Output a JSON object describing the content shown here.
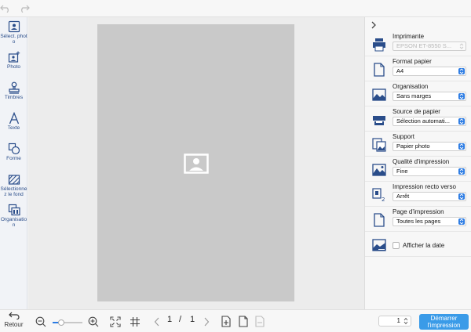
{
  "toolbar_left": {
    "items": [
      {
        "label": "Sélect. photo",
        "icon": "select-photo-icon"
      },
      {
        "label": "Photo",
        "icon": "add-photo-icon"
      },
      {
        "label": "Timbres",
        "icon": "stamp-icon"
      },
      {
        "label": "Texte",
        "icon": "text-icon"
      },
      {
        "label": "Forme",
        "icon": "shape-icon"
      },
      {
        "label": "Sélectionnez le fond",
        "icon": "background-icon"
      },
      {
        "label": "Organisation",
        "icon": "layout-icon"
      }
    ]
  },
  "settings": {
    "printer": {
      "title": "Imprimante",
      "value": "EPSON ET-8550 S..."
    },
    "paper_format": {
      "title": "Format papier",
      "value": "A4"
    },
    "organisation": {
      "title": "Organisation",
      "value": "Sans marges"
    },
    "paper_source": {
      "title": "Source de papier",
      "value": "Sélection automati..."
    },
    "support": {
      "title": "Support",
      "value": "Papier photo"
    },
    "quality": {
      "title": "Qualité d'impression",
      "value": "Fine"
    },
    "duplex": {
      "title": "Impression recto verso",
      "value": "Arrêt"
    },
    "print_page": {
      "title": "Page d'impression",
      "value": "Toutes les pages"
    },
    "show_date": {
      "label": "Afficher la date",
      "checked": false
    }
  },
  "bottom": {
    "back_label": "Retour",
    "zoom_level": 0.3,
    "current_page": "1",
    "separator": "/",
    "total_pages": "1",
    "copies": "1",
    "start_label_1": "Démarrer",
    "start_label_2": "l'impression"
  },
  "colors": {
    "accent": "#2b7be3",
    "start_button": "#3a9be8",
    "icon_blue": "#2a4d8a"
  }
}
